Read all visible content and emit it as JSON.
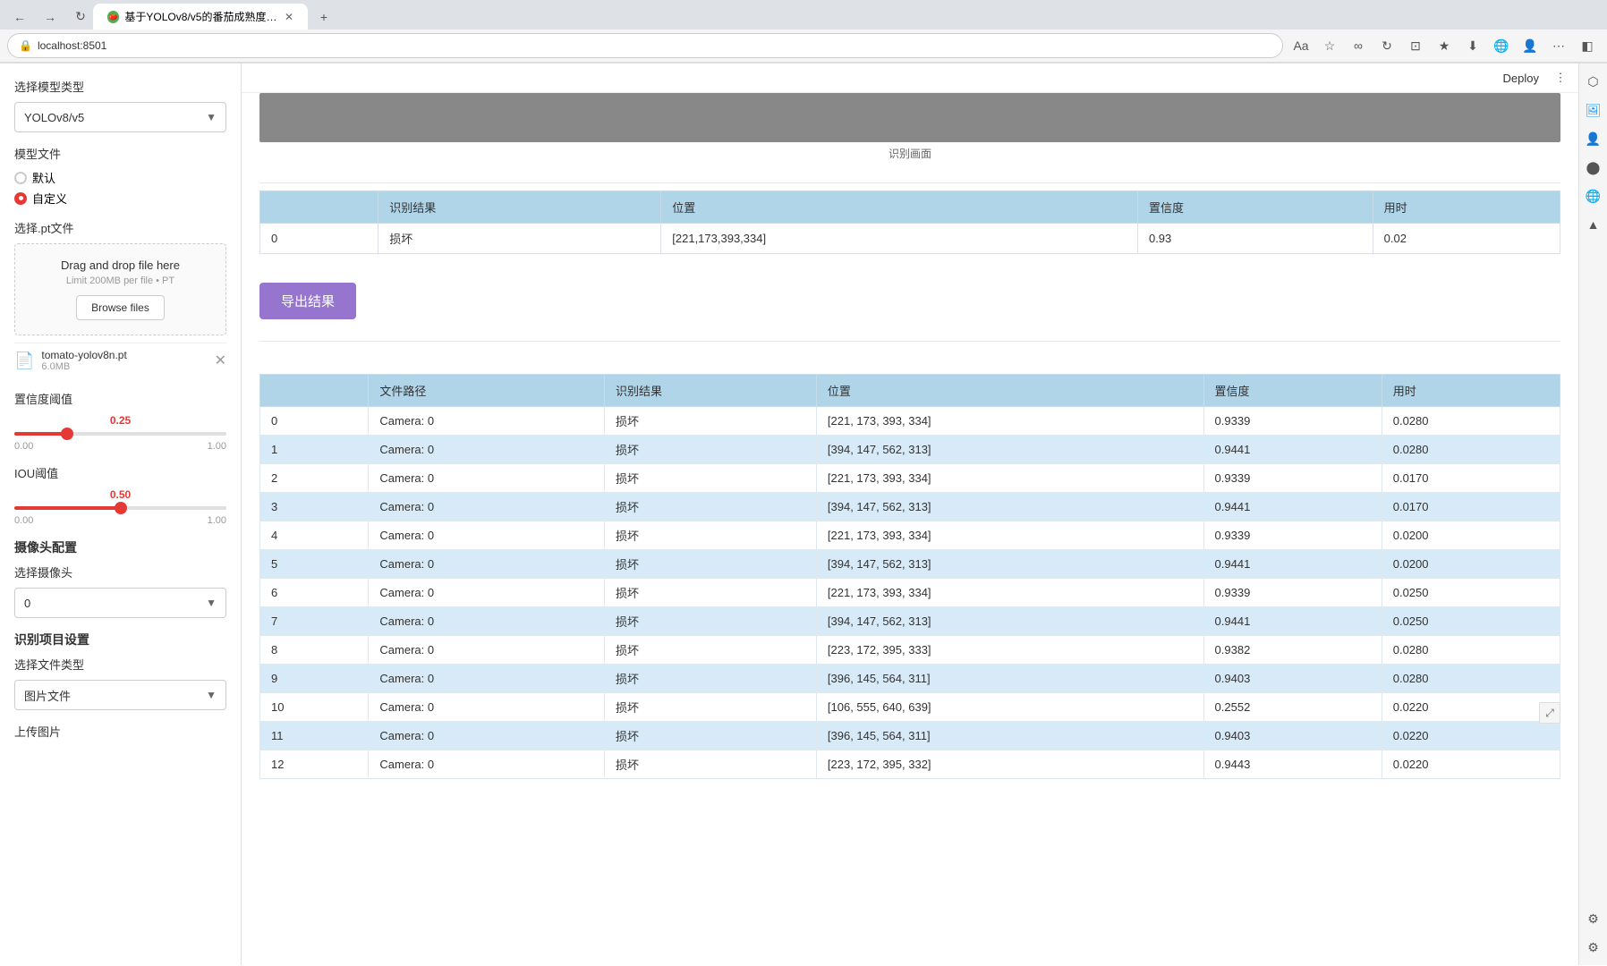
{
  "browser": {
    "tab_title": "基于YOLOv8/v5的番茄成熟度检...",
    "address": "localhost:8501",
    "new_tab_label": "+"
  },
  "topbar": {
    "deploy_label": "Deploy",
    "more_label": "⋮"
  },
  "sidebar": {
    "model_type_label": "选择模型类型",
    "model_type_value": "YOLOv8/v5",
    "model_file_label": "模型文件",
    "radio_default": "默认",
    "radio_custom": "自定义",
    "pt_file_label": "选择.pt文件",
    "upload_drag_text": "Drag and drop file here",
    "upload_limit_text": "Limit 200MB per file • PT",
    "browse_btn_label": "Browse files",
    "file_name": "tomato-yolov8n.pt",
    "file_size": "6.0MB",
    "confidence_label": "置信度阈值",
    "confidence_value": "0.25",
    "confidence_min": "0.00",
    "confidence_max": "1.00",
    "iou_label": "IOU阈值",
    "iou_value": "0.50",
    "iou_min": "0.00",
    "iou_max": "1.00",
    "camera_config_label": "摄像头配置",
    "camera_select_label": "选择摄像头",
    "camera_value": "0",
    "project_label": "识别项目设置",
    "file_type_label": "选择文件类型",
    "file_type_value": "图片文件",
    "upload_image_label": "上传图片"
  },
  "main": {
    "image_caption": "识别画面",
    "detection_table": {
      "headers": [
        "",
        "识别结果",
        "位置",
        "置信度",
        "用时"
      ],
      "rows": [
        {
          "index": "0",
          "result": "损坏",
          "position": "[221,173,393,334]",
          "confidence": "0.93",
          "time": "0.02"
        }
      ]
    },
    "export_btn_label": "导出结果",
    "results_table": {
      "headers": [
        "",
        "文件路径",
        "识别结果",
        "位置",
        "置信度",
        "用时"
      ],
      "rows": [
        {
          "index": "0",
          "path": "Camera: 0",
          "result": "损坏",
          "position": "[221, 173, 393, 334]",
          "confidence": "0.9339",
          "time": "0.0280"
        },
        {
          "index": "1",
          "path": "Camera: 0",
          "result": "损坏",
          "position": "[394, 147, 562, 313]",
          "confidence": "0.9441",
          "time": "0.0280"
        },
        {
          "index": "2",
          "path": "Camera: 0",
          "result": "损坏",
          "position": "[221, 173, 393, 334]",
          "confidence": "0.9339",
          "time": "0.0170"
        },
        {
          "index": "3",
          "path": "Camera: 0",
          "result": "损坏",
          "position": "[394, 147, 562, 313]",
          "confidence": "0.9441",
          "time": "0.0170"
        },
        {
          "index": "4",
          "path": "Camera: 0",
          "result": "损坏",
          "position": "[221, 173, 393, 334]",
          "confidence": "0.9339",
          "time": "0.0200"
        },
        {
          "index": "5",
          "path": "Camera: 0",
          "result": "损坏",
          "position": "[394, 147, 562, 313]",
          "confidence": "0.9441",
          "time": "0.0200"
        },
        {
          "index": "6",
          "path": "Camera: 0",
          "result": "损坏",
          "position": "[221, 173, 393, 334]",
          "confidence": "0.9339",
          "time": "0.0250"
        },
        {
          "index": "7",
          "path": "Camera: 0",
          "result": "损坏",
          "position": "[394, 147, 562, 313]",
          "confidence": "0.9441",
          "time": "0.0250"
        },
        {
          "index": "8",
          "path": "Camera: 0",
          "result": "损坏",
          "position": "[223, 172, 395, 333]",
          "confidence": "0.9382",
          "time": "0.0280"
        },
        {
          "index": "9",
          "path": "Camera: 0",
          "result": "损坏",
          "position": "[396, 145, 564, 311]",
          "confidence": "0.9403",
          "time": "0.0280"
        },
        {
          "index": "10",
          "path": "Camera: 0",
          "result": "损坏",
          "position": "[106, 555, 640, 639]",
          "confidence": "0.2552",
          "time": "0.0220"
        },
        {
          "index": "11",
          "path": "Camera: 0",
          "result": "损坏",
          "position": "[396, 145, 564, 311]",
          "confidence": "0.9403",
          "time": "0.0220"
        },
        {
          "index": "12",
          "path": "Camera: 0",
          "result": "损坏",
          "position": "[223, 172, 395, 332]",
          "confidence": "0.9443",
          "time": "0.0220"
        }
      ]
    }
  },
  "right_panel": {
    "icons": [
      "🔍",
      "🖼",
      "👤",
      "🔵",
      "⭐",
      "🌐",
      "▲"
    ]
  },
  "colors": {
    "table_header_bg": "#b0d4e8",
    "table_alt_row": "#d6eaf8",
    "export_btn_bg": "#9575cd",
    "slider_color": "#e53935",
    "selected_radio": "#e53935"
  }
}
